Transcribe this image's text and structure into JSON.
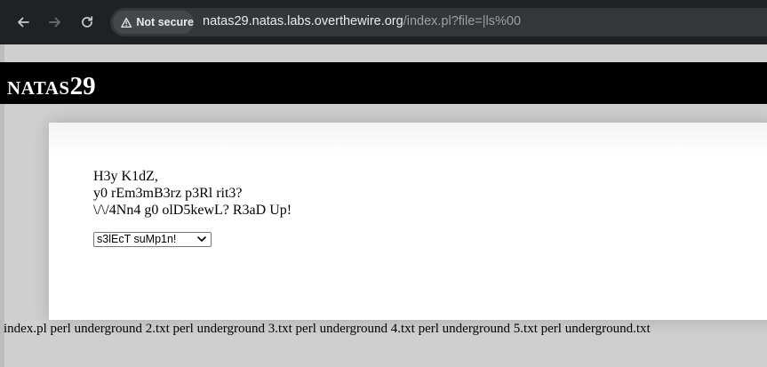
{
  "browser": {
    "security_label": "Not secure",
    "url_host": "natas29.natas.labs.overthewire.org",
    "url_path": "/index.pl?file=|ls%00",
    "icons": {
      "back": "arrow-left-icon",
      "forward": "arrow-right-icon",
      "reload": "reload-icon",
      "warning": "warning-triangle-icon"
    }
  },
  "header": {
    "title_small": "NATAS",
    "title_big": "29"
  },
  "content": {
    "lines": [
      "H3y K1dZ,",
      "y0 rEm3mB3rz p3Rl rit3?",
      "\\/\\/4Nn4 g0 olD5kewL? R3aD Up!"
    ],
    "select": {
      "selected": "s3lEcT suMp1n!"
    }
  },
  "output": {
    "text": "index.pl perl underground 2.txt perl underground 3.txt perl underground 4.txt perl underground 5.txt perl underground.txt"
  },
  "colors": {
    "chrome_bg": "#202124",
    "omnibox_bg": "#35363a",
    "page_bg": "#cfcfcf",
    "header_bg": "#000000"
  }
}
